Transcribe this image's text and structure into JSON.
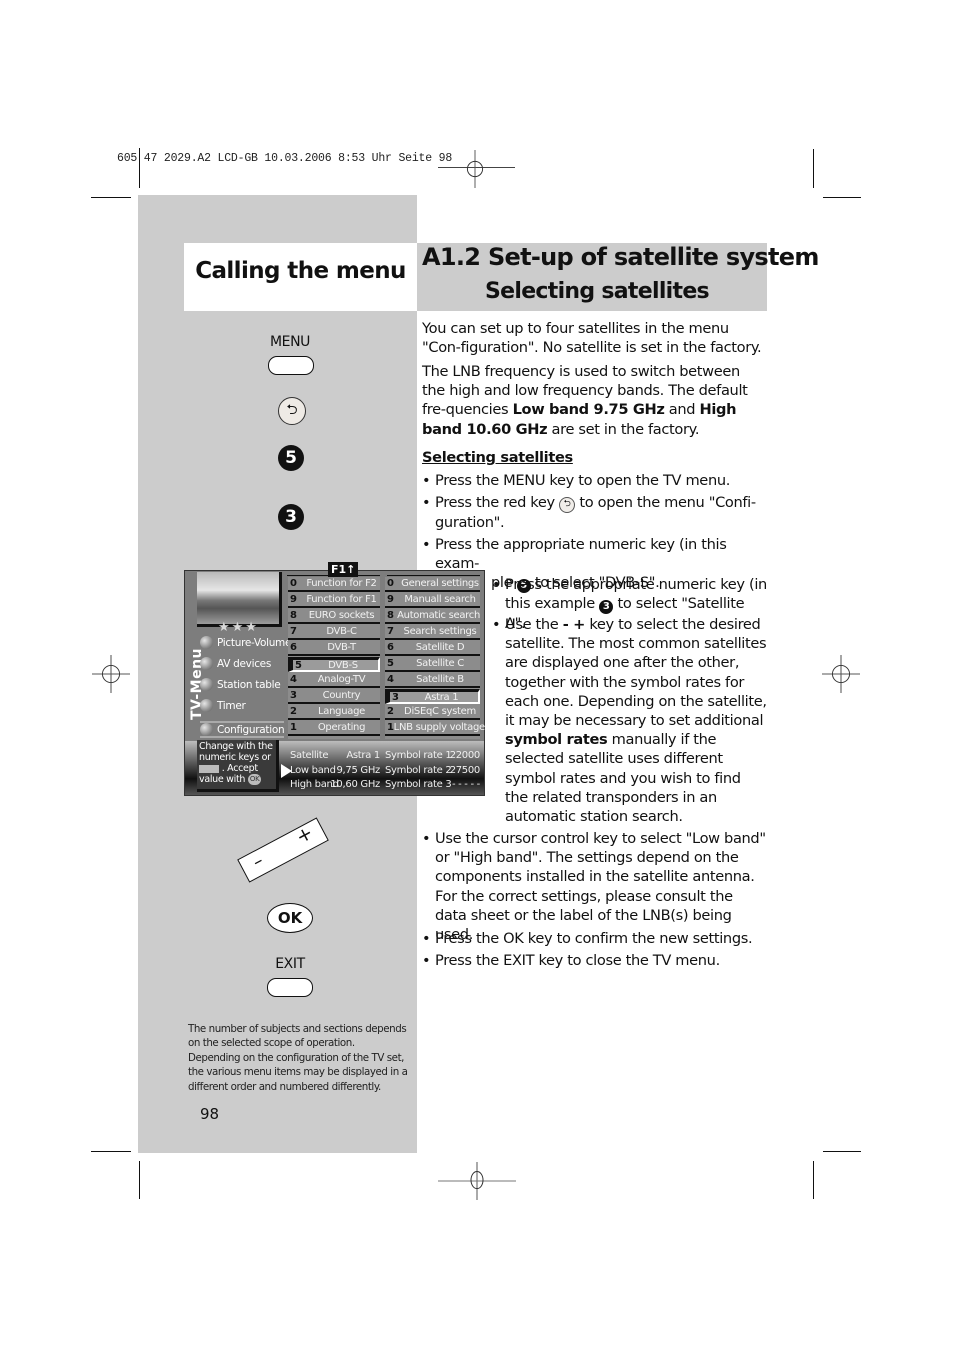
{
  "print_header": "605 47 2029.A2 LCD-GB  10.03.2006  8:53 Uhr  Seite 98",
  "titles": {
    "left": "Calling the menu",
    "right_line1": "A1.2 Set-up of satellite system",
    "right_line2": "Selecting satellites"
  },
  "keys": {
    "menu_label": "MENU",
    "red_key_icon": "return-arrow-icon",
    "num5": "5",
    "num3": "3",
    "rocker_minus": "–",
    "rocker_plus": "+",
    "ok_label": "OK",
    "exit_label": "EXIT"
  },
  "tv_screen": {
    "f1_label": "F1",
    "stars": "★★★",
    "vertical_title": "TV-Menu",
    "main_menu": [
      "Picture-Volume",
      "AV devices",
      "Station table",
      "Timer",
      "Configuration"
    ],
    "config_menu": [
      {
        "num": "0",
        "label": "Function for F2"
      },
      {
        "num": "9",
        "label": "Function for F1"
      },
      {
        "num": "8",
        "label": "EURO sockets"
      },
      {
        "num": "7",
        "label": "DVB-C"
      },
      {
        "num": "6",
        "label": "DVB-T"
      },
      {
        "num": "5",
        "label": "DVB-S",
        "selected": true
      },
      {
        "num": "4",
        "label": "Analog-TV"
      },
      {
        "num": "3",
        "label": "Country"
      },
      {
        "num": "2",
        "label": "Language"
      },
      {
        "num": "1",
        "label": "Operating"
      }
    ],
    "dvbs_menu": [
      {
        "num": "0",
        "label": "General settings"
      },
      {
        "num": "9",
        "label": "Manuall search"
      },
      {
        "num": "8",
        "label": "Automatic search"
      },
      {
        "num": "7",
        "label": "Search settings"
      },
      {
        "num": "6",
        "label": "Satellite D"
      },
      {
        "num": "5",
        "label": "Satellite C"
      },
      {
        "num": "4",
        "label": "Satellite B"
      },
      {
        "num": "3",
        "label": "Astra 1",
        "selected": true
      },
      {
        "num": "2",
        "label": "DiSEqC system"
      },
      {
        "num": "1",
        "label": "LNB supply voltage"
      }
    ],
    "help": {
      "line1": "Change with the",
      "line2": "numeric keys or",
      "line3": ". Accept",
      "line4": "value with",
      "ok": "OK"
    },
    "info": {
      "rows": [
        {
          "label": "Satellite",
          "value": "Astra 1",
          "rate_label": "Symbol rate 1",
          "rate": "22000"
        },
        {
          "label": "Low band",
          "value": "9,75 GHz",
          "rate_label": "Symbol rate 2",
          "rate": "27500"
        },
        {
          "label": "High band",
          "value": "10,60 GHz",
          "rate_label": "Symbol rate 3",
          "rate": "- - - - -"
        }
      ]
    }
  },
  "footnote": "The number of subjects and sections depends on the selected scope of operation. Depending on the configuration of the TV set, the various menu items may be displayed in a different order and numbered differently.",
  "page_number": "98",
  "body": {
    "p1": "You can set up to four satellites in the menu \"Con-figuration\". No satellite is set in the factory.",
    "p2_a": "The LNB frequency is used to switch between the high and low frequency bands. The default fre-quencies ",
    "p2_b1": "Low band 9.75  GHz",
    "p2_and": " and ",
    "p2_b2": "High band 10.60 GHz",
    "p2_c": " are set in the factory.",
    "subhead": "Selecting satellites",
    "b1": "Press the MENU key to open the TV menu.",
    "b2_a": "Press the red key ",
    "b2_b": " to open the menu \"Confi-guration\".",
    "b3_a": "Press the appropriate numeric key (in this exam-",
    "b3_b": "ple ",
    "b3_num": "5",
    "b3_c": " to select \"DVB-S\".",
    "b4_a": "Press the appropriate numeric key (in this example ",
    "b4_num": "3",
    "b4_b": " to select \"Satellite A\".",
    "b5_a": "Use the ",
    "b5_key": "- +",
    "b5_b": " key to select the desired satellite. The most common satellites are displayed one after the other, together with the symbol rates for each one. Depending on the satellite, it may be necessary to set additional ",
    "b5_bold": "symbol rates",
    "b5_c": " manually if the selected satellite uses different symbol rates and you wish to find the related transponders in an automatic station search.",
    "b6": "Use the cursor control key to select \"Low band\" or \"High band\". The settings depend on the components installed in the satellite antenna. For the correct settings, please consult the data sheet or the label of the LNB(s) being used.",
    "b7": "Press the OK key to confirm the new settings.",
    "b8": "Press the EXIT key to close the TV menu.",
    "bullet_char": "•"
  }
}
